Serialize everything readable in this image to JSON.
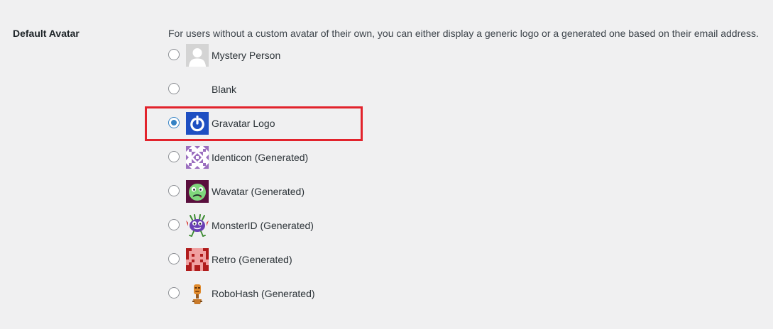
{
  "setting": {
    "label": "Default Avatar",
    "description": "For users without a custom avatar of their own, you can either display a generic logo or a generated one based on their email address."
  },
  "options": [
    {
      "label": "Mystery Person",
      "icon": "mystery-person-icon",
      "checked": false
    },
    {
      "label": "Blank",
      "icon": "blank-icon",
      "checked": false
    },
    {
      "label": "Gravatar Logo",
      "icon": "gravatar-logo-icon",
      "checked": true
    },
    {
      "label": "Identicon (Generated)",
      "icon": "identicon-icon",
      "checked": false
    },
    {
      "label": "Wavatar (Generated)",
      "icon": "wavatar-icon",
      "checked": false
    },
    {
      "label": "MonsterID (Generated)",
      "icon": "monsterid-icon",
      "checked": false
    },
    {
      "label": "Retro (Generated)",
      "icon": "retro-icon",
      "checked": false
    },
    {
      "label": "RoboHash (Generated)",
      "icon": "robohash-icon",
      "checked": false
    }
  ],
  "colors": {
    "accent": "#3582c4",
    "highlight": "#e2232c",
    "background": "#f0f0f1",
    "gravatar_blue": "#1e4fc2"
  }
}
